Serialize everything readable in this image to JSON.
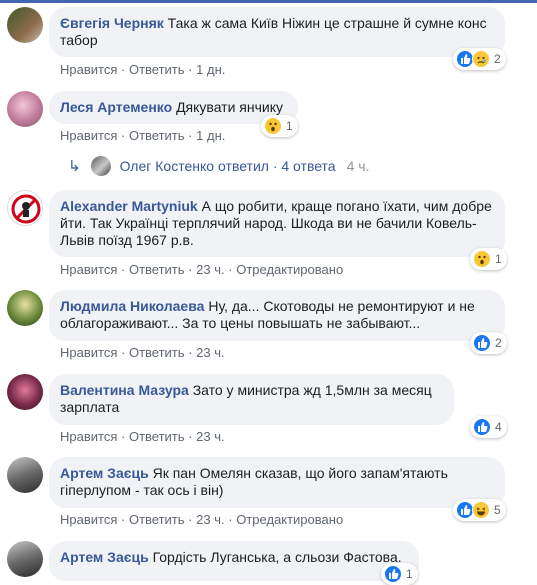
{
  "comments": [
    {
      "author": "Євгегія Черняк",
      "text": "Така ж сама Київ Ніжин це страшне й сумне конс табор",
      "like": "Нравится",
      "reply": "Ответить",
      "time": "1 дн.",
      "edited": "",
      "reactions": [
        "like-icon",
        "sad-icon"
      ],
      "count": "2"
    },
    {
      "author": "Леся Артеменко",
      "text": "Дякувати янчику",
      "like": "Нравится",
      "reply": "Ответить",
      "time": "1 дн.",
      "edited": "",
      "reactions": [
        "wow-icon"
      ],
      "count": "1"
    },
    {
      "author": "Alexander Martyniuk",
      "text": "А що робити, краще погано їхати, чим добре йти. Так Українці терплячий народ. Шкода ви не бачили Ковель-Львів поїзд 1967 р.в.",
      "like": "Нравится",
      "reply": "Ответить",
      "time": "23 ч.",
      "edited": "Отредактировано",
      "reactions": [
        "wow-icon"
      ],
      "count": "1"
    },
    {
      "author": "Людмила Николаева",
      "text": "Ну, да... Скотоводы не ремонтируют и не облагораживают... За то цены повышать не забывают...",
      "like": "Нравится",
      "reply": "Ответить",
      "time": "23 ч.",
      "edited": "",
      "reactions": [
        "like-icon"
      ],
      "count": "2"
    },
    {
      "author": "Валентина Мазура",
      "text": "Зато у министра жд 1,5млн за месяц зарплата",
      "like": "Нравится",
      "reply": "Ответить",
      "time": "23 ч.",
      "edited": "",
      "reactions": [
        "like-icon"
      ],
      "count": "4"
    },
    {
      "author": "Артем Заєць",
      "text": "Як пан Омелян сказав, що його запам'ятають гіперлупом - так ось і він)",
      "like": "Нравится",
      "reply": "Ответить",
      "time": "23 ч.",
      "edited": "Отредактировано",
      "reactions": [
        "like-icon",
        "haha-icon"
      ],
      "count": "5"
    },
    {
      "author": "Артем Заєць",
      "text": "Гордість Луганська, а сльози Фастова.",
      "like": "",
      "reply": "",
      "time": "",
      "edited": "",
      "reactions": [
        "like-icon"
      ],
      "count": "1"
    }
  ],
  "reply_thread": {
    "author": "Олег Костенко",
    "label": "ответил · 4 ответа",
    "time": "4 ч."
  },
  "separator": "·",
  "colors": {
    "link": "#385898",
    "bubble": "#f0f2f5",
    "like": "#1877f2",
    "emoji": "#f7c736"
  }
}
